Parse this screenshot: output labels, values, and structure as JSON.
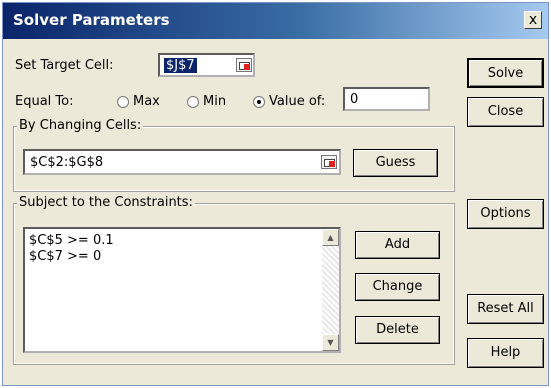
{
  "dialog": {
    "title": "Solver Parameters",
    "close_glyph": "x"
  },
  "target": {
    "label": "Set Target Cell:",
    "value": "$J$7"
  },
  "equal_to": {
    "label": "Equal To:",
    "options": [
      {
        "label": "Max",
        "selected": false
      },
      {
        "label": "Min",
        "selected": false
      },
      {
        "label": "Value of:",
        "selected": true
      }
    ],
    "value": "0"
  },
  "changing": {
    "label": "By Changing Cells:",
    "value": "$C$2:$G$8",
    "guess_button": "Guess"
  },
  "constraints": {
    "label": "Subject to the Constraints:",
    "items": [
      "$C$5 >= 0.1",
      "$C$7 >= 0"
    ],
    "add_button": "Add",
    "change_button": "Change",
    "delete_button": "Delete"
  },
  "side_buttons": {
    "solve": "Solve",
    "close": "Close",
    "options": "Options",
    "reset": "Reset All",
    "help": "Help"
  },
  "icons": [
    "range-picker-icon",
    "scroll-up-icon",
    "scroll-down-icon",
    "radio-icon"
  ]
}
